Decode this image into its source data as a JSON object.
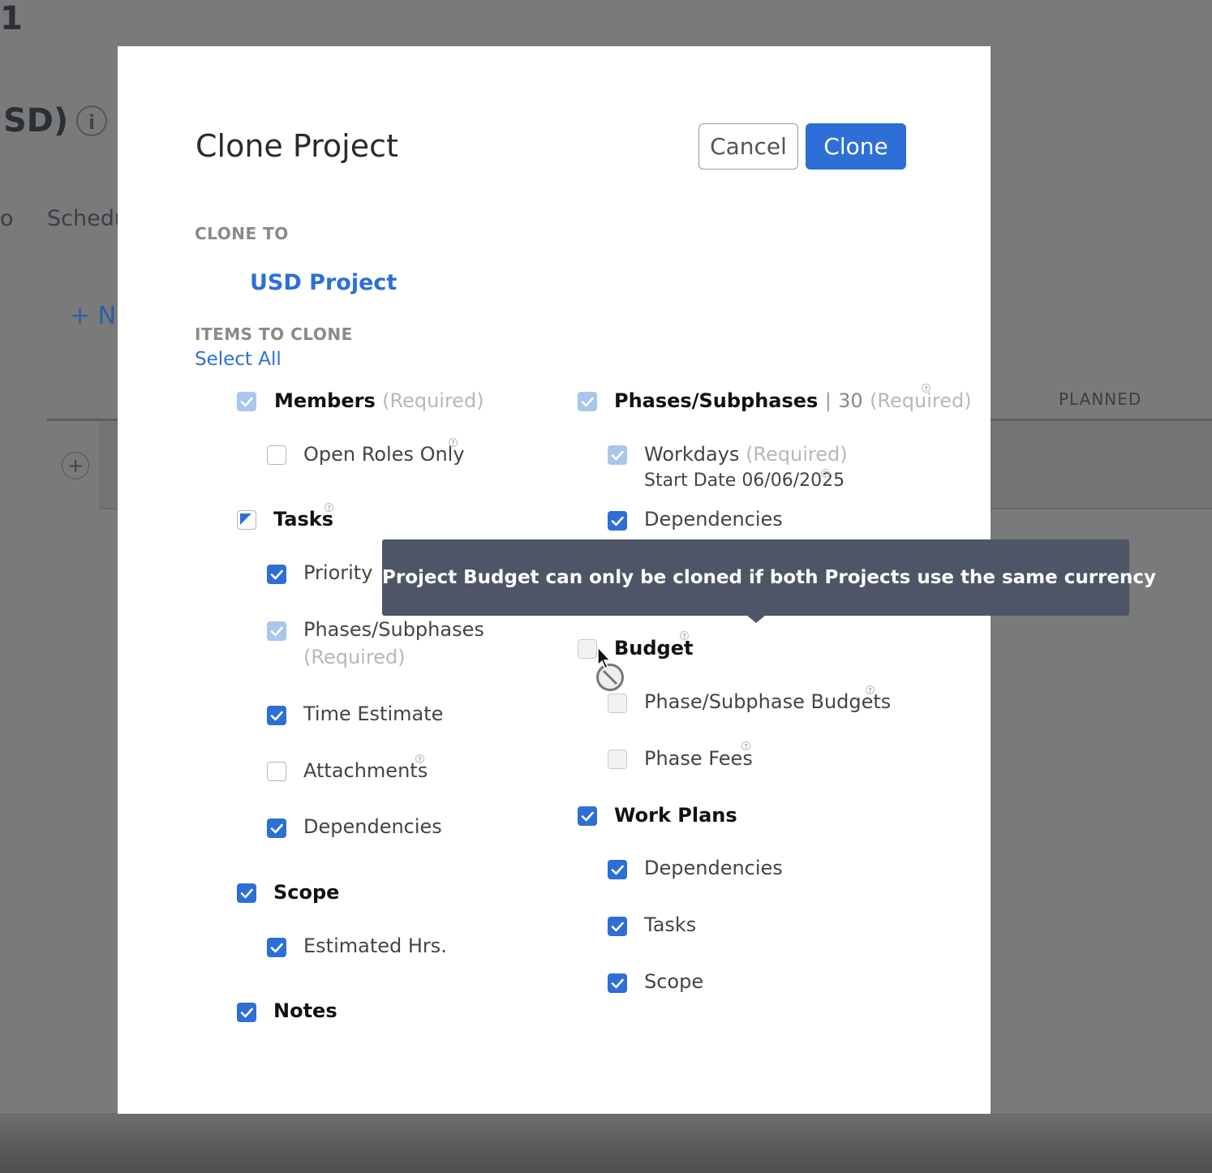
{
  "background": {
    "title_fragment": "1",
    "subtitle_fragment": "SD)",
    "info_icon": "i",
    "tab_fragments": [
      "o",
      "Schedu"
    ],
    "new_button_fragment": "+ Ne",
    "column_header": "PLANNED",
    "add_icon": "+"
  },
  "modal": {
    "title": "Clone Project",
    "cancel_label": "Cancel",
    "clone_label": "Clone",
    "clone_to_label": "CLONE TO",
    "target_project": "USD Project",
    "items_label": "ITEMS TO CLONE",
    "select_all": "Select All",
    "required_text": "(Required)",
    "help_glyph": "?",
    "left_column": {
      "members": "Members",
      "open_roles_only": "Open Roles Only",
      "tasks": "Tasks",
      "priority": "Priority",
      "phases_subphases": "Phases/Subphases",
      "time_estimate": "Time Estimate",
      "attachments": "Attachments",
      "dependencies": "Dependencies",
      "scope": "Scope",
      "estimated_hrs": "Estimated Hrs.",
      "notes": "Notes"
    },
    "right_column": {
      "phases_subphases": "Phases/Subphases",
      "separator": "|",
      "phase_count": "30",
      "workdays": "Workdays",
      "start_date": "Start Date 06/06/2025",
      "dependencies": "Dependencies",
      "budget": "Budget",
      "phase_subphase_budgets": "Phase/Subphase Budgets",
      "phase_fees": "Phase Fees",
      "work_plans": "Work Plans",
      "wp_dependencies": "Dependencies",
      "wp_tasks": "Tasks",
      "wp_scope": "Scope"
    },
    "tooltip": "Project Budget can only be cloned if both Projects use the same currency"
  },
  "colors": {
    "accent": "#2d6fd6",
    "tooltip_bg": "#4e5566",
    "overlay": "#7a7a7a"
  }
}
